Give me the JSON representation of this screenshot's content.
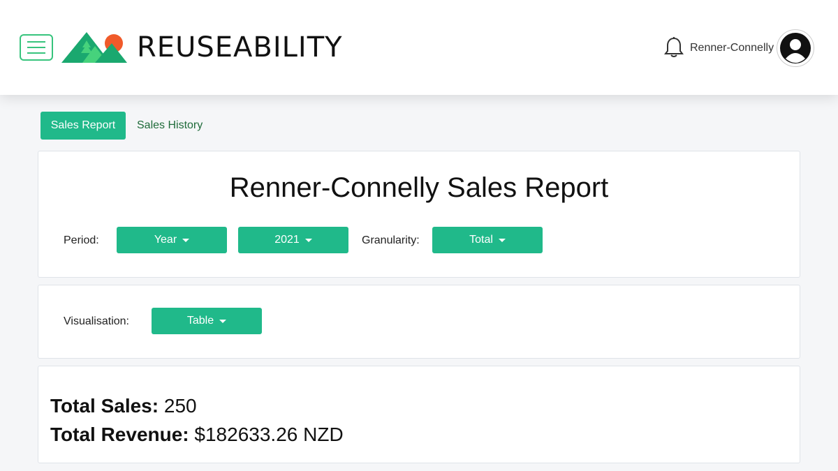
{
  "header": {
    "brand": "REUSEABILITY",
    "username": "Renner-Connelly",
    "icons": {
      "menu": "hamburger-menu-icon",
      "logo": "mountains-sun-logo",
      "notification": "bell-icon",
      "avatar": "user-avatar-icon"
    }
  },
  "tabs": {
    "active": "Sales Report",
    "other": "Sales History"
  },
  "report": {
    "title": "Renner-Connelly Sales Report",
    "period_label": "Period:",
    "period_value": "Year",
    "year_value": "2021",
    "granularity_label": "Granularity:",
    "granularity_value": "Total",
    "visualisation_label": "Visualisation:",
    "visualisation_value": "Table"
  },
  "stats": {
    "sales_label": "Total Sales:",
    "sales_value": "250",
    "revenue_label": "Total Revenue:",
    "revenue_value": "$182633.26 NZD"
  },
  "colors": {
    "accent": "#20b98a",
    "menu_border": "#37c47d",
    "link": "#1f6b3a",
    "logo_sun": "#f05a2a",
    "logo_mountain_dark": "#1aa86f",
    "logo_mountain_light": "#46d27c"
  }
}
